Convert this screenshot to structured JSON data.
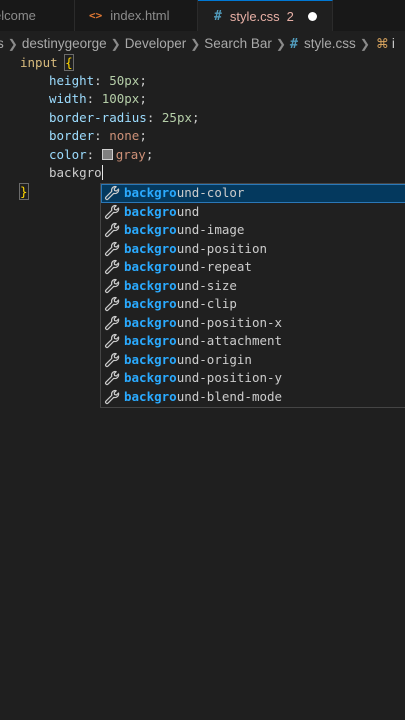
{
  "tabs": [
    {
      "label": "elcome"
    },
    {
      "icon": "html-file-icon",
      "icon_glyph": "<>",
      "label": "index.html"
    },
    {
      "icon": "css-file-icon",
      "icon_glyph": "#",
      "label": "style.css",
      "problems": "2",
      "unsaved": true
    }
  ],
  "breadcrumb": [
    "s",
    "destinygeorge",
    "Developer",
    "Search Bar",
    "style.css",
    "i"
  ],
  "code": {
    "selector": "input",
    "open_brace": "{",
    "close_brace": "}",
    "declarations": [
      {
        "prop": "height",
        "value": "50px"
      },
      {
        "prop": "width",
        "value": "100px"
      },
      {
        "prop": "border-radius",
        "value": "25px"
      },
      {
        "prop": "border",
        "value": "none"
      },
      {
        "prop": "color",
        "value": "gray",
        "swatch": "#808080"
      }
    ],
    "typing": "backgro"
  },
  "suggestions": {
    "match": "backgro",
    "items": [
      {
        "rest": "und-color",
        "active": true
      },
      {
        "rest": "und"
      },
      {
        "rest": "und-image"
      },
      {
        "rest": "und-position"
      },
      {
        "rest": "und-repeat"
      },
      {
        "rest": "und-size"
      },
      {
        "rest": "und-clip"
      },
      {
        "rest": "und-position-x"
      },
      {
        "rest": "und-attachment"
      },
      {
        "rest": "und-origin"
      },
      {
        "rest": "und-position-y"
      },
      {
        "rest": "und-blend-mode"
      }
    ]
  },
  "colors": {
    "editor_bg": "#1f1f1f",
    "tabbar_bg": "#181818",
    "match_highlight": "#2aaaff",
    "active_suggestion_bg": "#04395e"
  }
}
